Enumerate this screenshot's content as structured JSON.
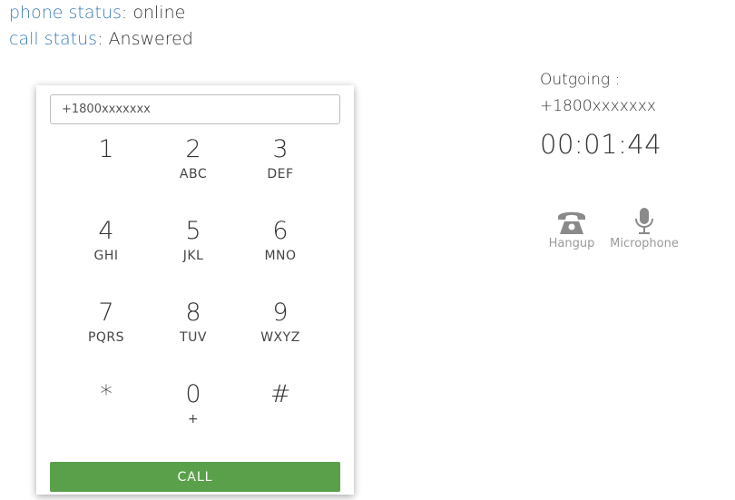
{
  "status": {
    "phone_key": "phone status",
    "phone_value": "online",
    "call_key": "call status",
    "call_value": "Answered"
  },
  "dialer": {
    "input_value": "+1800xxxxxxx",
    "keys": [
      {
        "digit": "1",
        "letters": ""
      },
      {
        "digit": "2",
        "letters": "ABC"
      },
      {
        "digit": "3",
        "letters": "DEF"
      },
      {
        "digit": "4",
        "letters": "GHI"
      },
      {
        "digit": "5",
        "letters": "JKL"
      },
      {
        "digit": "6",
        "letters": "MNO"
      },
      {
        "digit": "7",
        "letters": "PQRS"
      },
      {
        "digit": "8",
        "letters": "TUV"
      },
      {
        "digit": "9",
        "letters": "WXYZ"
      },
      {
        "digit": "*",
        "letters": ""
      },
      {
        "digit": "0",
        "letters": "+"
      },
      {
        "digit": "#",
        "letters": ""
      }
    ],
    "call_label": "CALL"
  },
  "call": {
    "direction_label": "Outgoing :",
    "number": "+1800xxxxxxx",
    "timer": "00:01:44",
    "actions": [
      {
        "label": "Hangup",
        "icon": "phone-hangup-icon"
      },
      {
        "label": "Microphone",
        "icon": "microphone-icon"
      }
    ]
  },
  "colors": {
    "status_key": "#3a7cb8",
    "call_button": "#5aa04a",
    "action_icon": "#8a8a8a"
  }
}
